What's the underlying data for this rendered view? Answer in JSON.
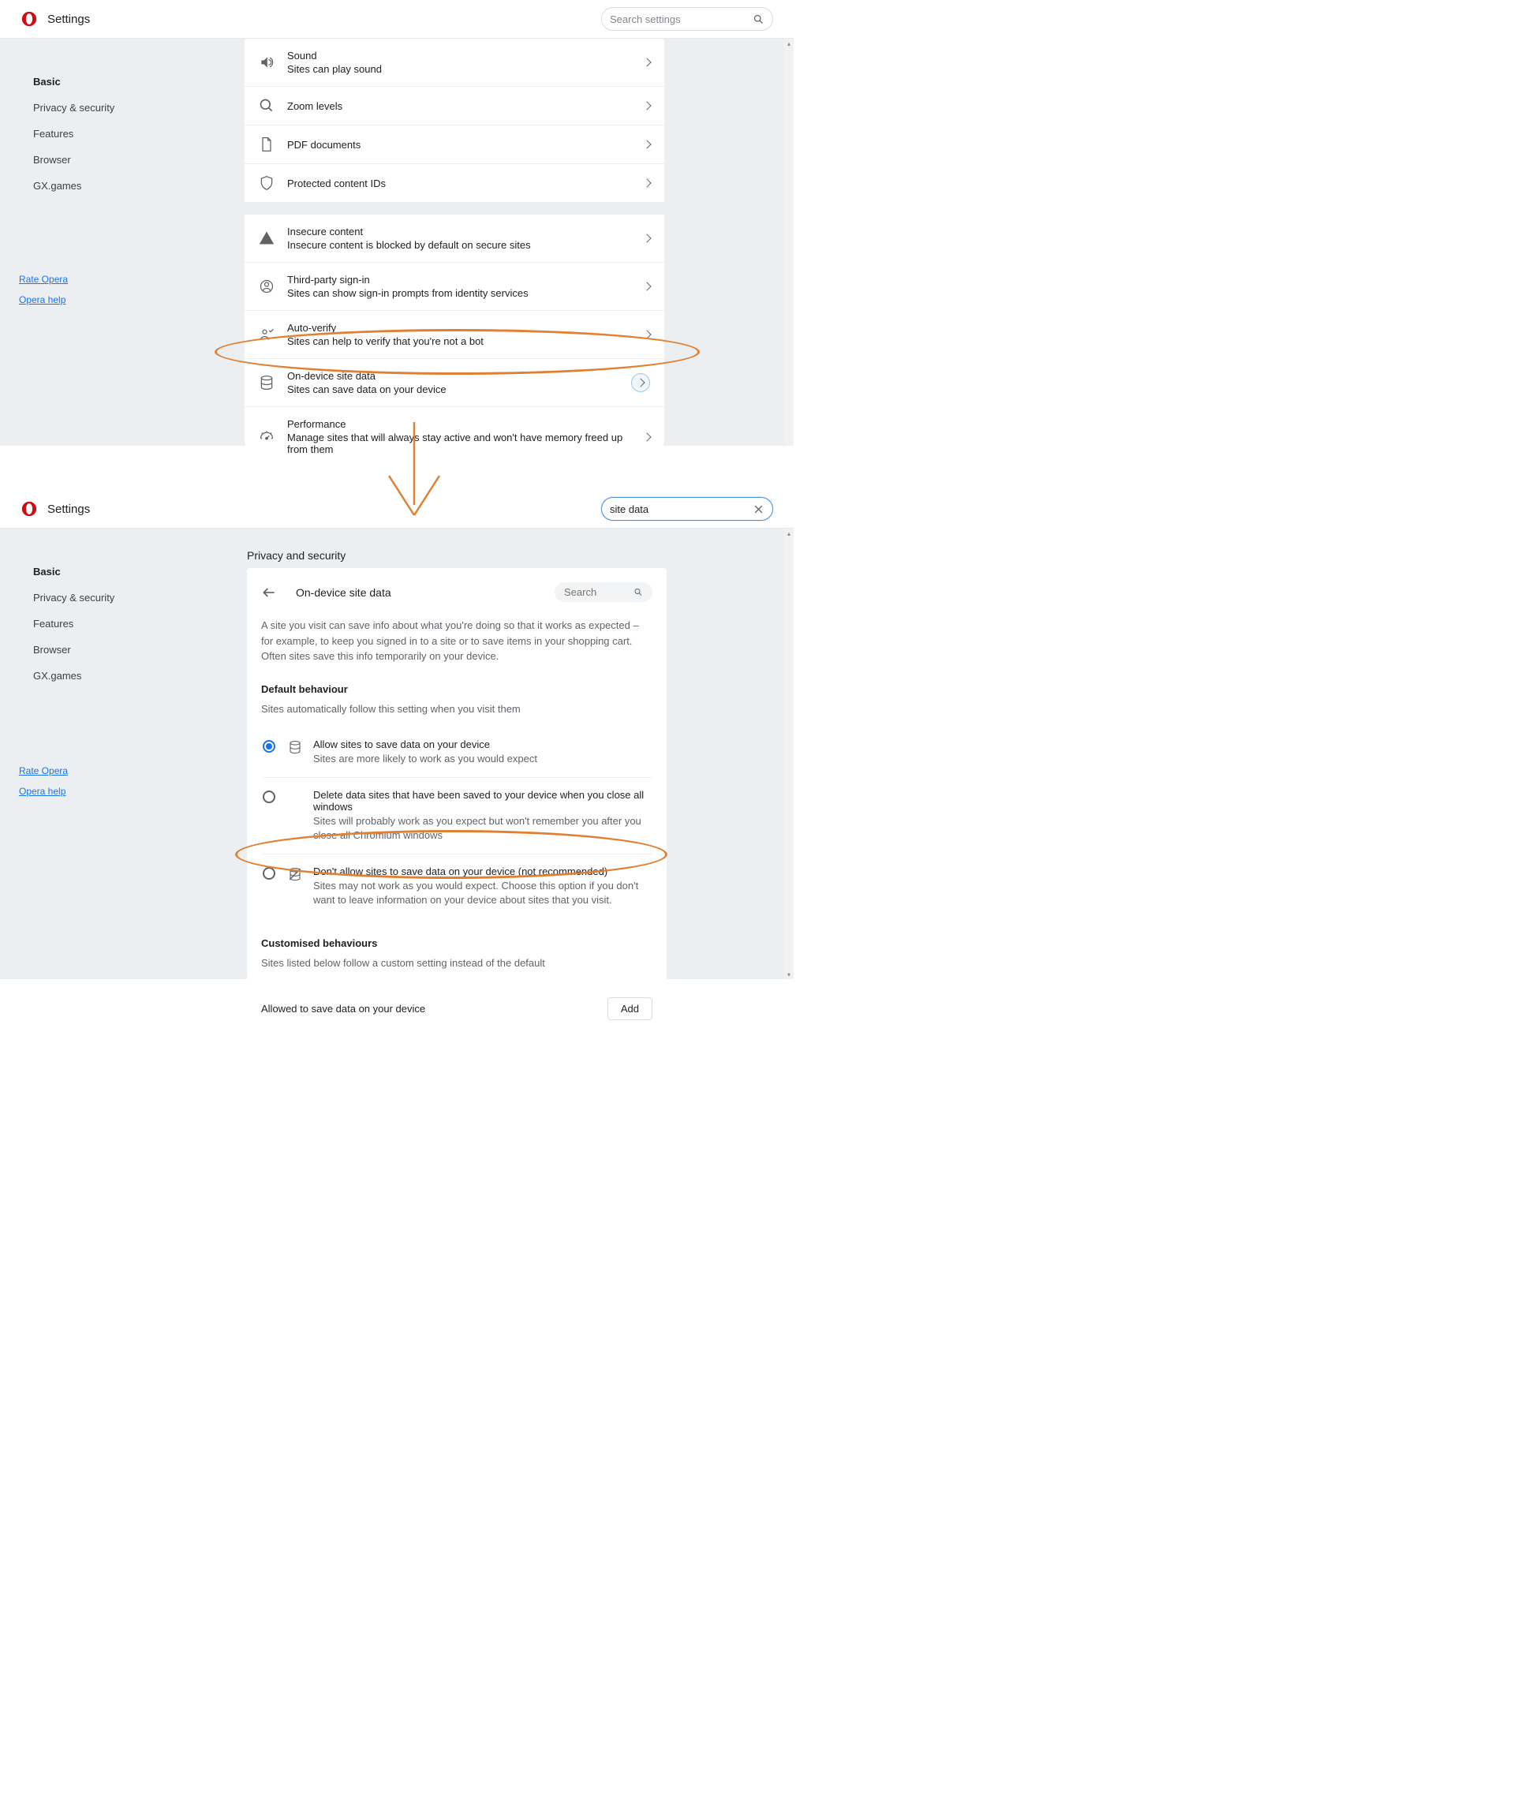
{
  "header": {
    "title": "Settings",
    "search_placeholder": "Search settings",
    "search_value_2": "site data"
  },
  "sidebar": {
    "items": [
      {
        "label": "Basic"
      },
      {
        "label": "Privacy & security"
      },
      {
        "label": "Features"
      },
      {
        "label": "Browser"
      },
      {
        "label": "GX.games"
      }
    ],
    "links": [
      {
        "label": "Rate Opera"
      },
      {
        "label": "Opera help"
      }
    ]
  },
  "screen1": {
    "rows": [
      {
        "title": "Sound",
        "subtitle": "Sites can play sound"
      },
      {
        "title": "Zoom levels",
        "subtitle": ""
      },
      {
        "title": "PDF documents",
        "subtitle": ""
      },
      {
        "title": "Protected content IDs",
        "subtitle": ""
      },
      {
        "title": "Insecure content",
        "subtitle": "Insecure content is blocked by default on secure sites"
      },
      {
        "title": "Third-party sign-in",
        "subtitle": "Sites can show sign-in prompts from identity services"
      },
      {
        "title": "Auto-verify",
        "subtitle": "Sites can help to verify that you're not a bot"
      },
      {
        "title": "On-device site data",
        "subtitle": "Sites can save data on your device"
      },
      {
        "title": "Performance",
        "subtitle": "Manage sites that will always stay active and won't have memory freed up from them"
      }
    ]
  },
  "screen2": {
    "section_heading": "Privacy and security",
    "card": {
      "title": "On-device site data",
      "search_placeholder": "Search",
      "description": "A site you visit can save info about what you're doing so that it works as expected – for example, to keep you signed in to a site or to save items in your shopping cart. Often sites save this info temporarily on your device.",
      "default_heading": "Default behaviour",
      "default_sub": "Sites automatically follow this setting when you visit them",
      "options": [
        {
          "title": "Allow sites to save data on your device",
          "sub": "Sites are more likely to work as you would expect"
        },
        {
          "title": "Delete data sites that have been saved to your device when you close all windows",
          "sub": "Sites will probably work as you expect but won't remember you after you close all Chromium windows"
        },
        {
          "title": "Don't allow sites to save data on your device (not recommended)",
          "sub": "Sites may not work as you would expect. Choose this option if you don't want to leave information on your device about sites that you visit."
        }
      ],
      "cust_heading": "Customised behaviours",
      "cust_sub": "Sites listed below follow a custom setting instead of the default",
      "allowed_label": "Allowed to save data on your device",
      "add_label": "Add"
    }
  }
}
